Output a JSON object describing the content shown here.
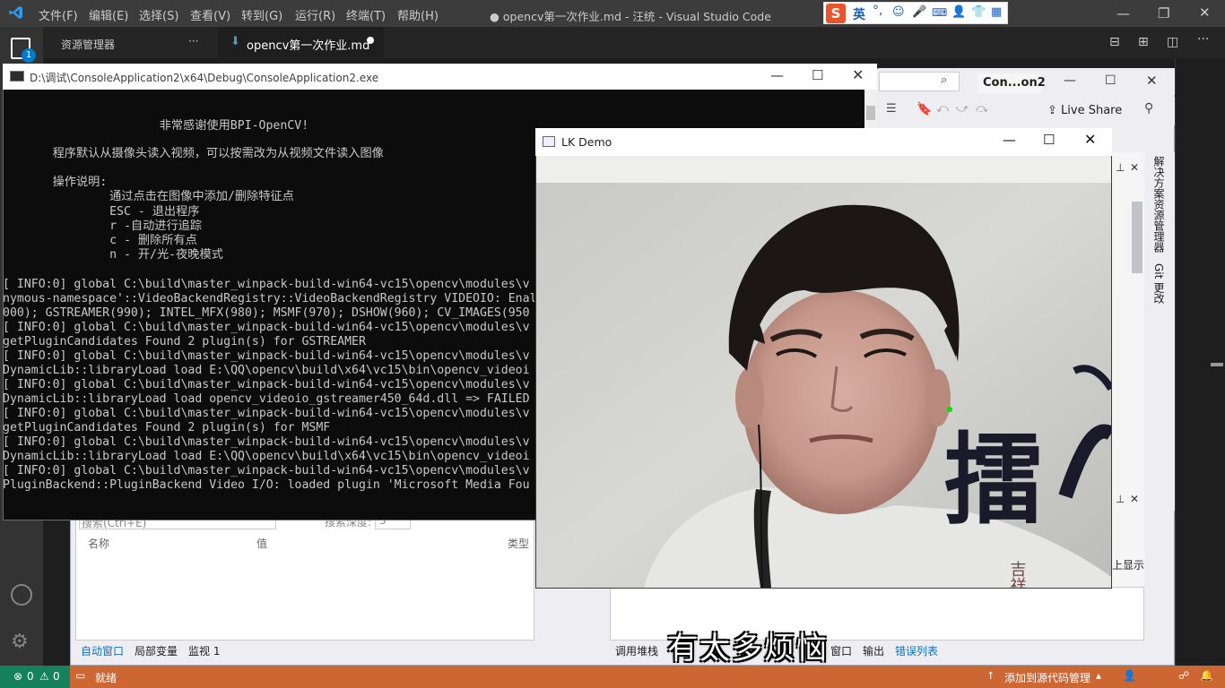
{
  "vscode": {
    "title": "● opencv第一次作业.md - 汪统 - Visual Studio Code",
    "menu": [
      "文件(F)",
      "编辑(E)",
      "选择(S)",
      "查看(V)",
      "转到(G)",
      "运行(R)",
      "终端(T)",
      "帮助(H)"
    ],
    "sidebar_title": "资源管理器",
    "sidebar_more": "···",
    "tab_label": "opencv第一次作业.md",
    "badge_count": "1",
    "status": {
      "errors": "0",
      "warnings": "0",
      "ready": "就绪",
      "add_source": "添加到源代码管理"
    }
  },
  "ime": {
    "lang": "英"
  },
  "visual_studio": {
    "compact_title": "Con...on2",
    "live_share": "Live Share",
    "side_tabs": [
      "解决方案资源管理器",
      "Git 更改"
    ],
    "autos_search": "搜索(Ctrl+E)",
    "search_depth_label": "搜索深度:",
    "search_depth_value": "3",
    "columns": [
      "名称",
      "值",
      "类型"
    ],
    "bottom_tabs_left": [
      "自动窗口",
      "局部变量",
      "监视 1"
    ],
    "bottom_tabs_right": [
      "调用堆栈",
      "窗口",
      "输出",
      "错误列表"
    ],
    "right_snippet": "上显示("
  },
  "console": {
    "title": "D:\\调试\\ConsoleApplication2\\x64\\Debug\\ConsoleApplication2.exe",
    "lines": [
      "                      非常感谢使用BPI-OpenCV!",
      "       程序默认从摄像头读入视频，可以按需改为从视频文件读入图像",
      "       操作说明:",
      "               通过点击在图像中添加/删除特征点",
      "               ESC - 退出程序",
      "               r -自动进行追踪",
      "               c - 删除所有点",
      "               n - 开/光-夜晚模式",
      "[ INFO:0] global C:\\build\\master_winpack-build-win64-vc15\\opencv\\modules\\v",
      "nymous-namespace'::VideoBackendRegistry::VideoBackendRegistry VIDEOIO: Enal",
      "000); GSTREAMER(990); INTEL_MFX(980); MSMF(970); DSHOW(960); CV_IMAGES(950",
      "[ INFO:0] global C:\\build\\master_winpack-build-win64-vc15\\opencv\\modules\\v",
      "getPluginCandidates Found 2 plugin(s) for GSTREAMER",
      "[ INFO:0] global C:\\build\\master_winpack-build-win64-vc15\\opencv\\modules\\v",
      "DynamicLib::libraryLoad load E:\\QQ\\opencv\\build\\x64\\vc15\\bin\\opencv_videoi",
      "[ INFO:0] global C:\\build\\master_winpack-build-win64-vc15\\opencv\\modules\\v",
      "DynamicLib::libraryLoad load opencv_videoio_gstreamer450_64d.dll => FAILED",
      "[ INFO:0] global C:\\build\\master_winpack-build-win64-vc15\\opencv\\modules\\v",
      "getPluginCandidates Found 2 plugin(s) for MSMF",
      "[ INFO:0] global C:\\build\\master_winpack-build-win64-vc15\\opencv\\modules\\v",
      "DynamicLib::libraryLoad load E:\\QQ\\opencv\\build\\x64\\vc15\\bin\\opencv_videoi",
      "[ INFO:0] global C:\\build\\master_winpack-build-win64-vc15\\opencv\\modules\\v",
      "PluginBackend::PluginBackend Video I/O: loaded plugin 'Microsoft Media Fou"
    ]
  },
  "lk_demo": {
    "title": "LK Demo",
    "calligraphy": "擂",
    "calligraphy2": "吉祥"
  },
  "subtitle": "有太多烦恼"
}
